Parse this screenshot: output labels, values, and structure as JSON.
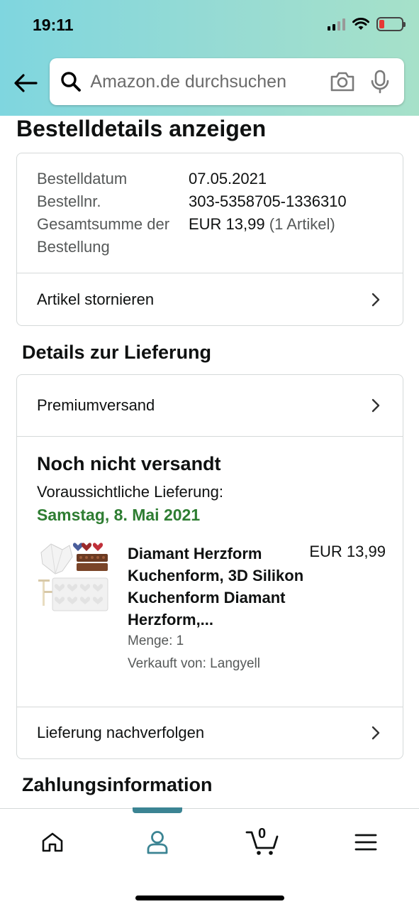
{
  "status_bar": {
    "time": "19:11"
  },
  "search": {
    "placeholder": "Amazon.de durchsuchen"
  },
  "page": {
    "title": "Bestelldetails anzeigen"
  },
  "order_summary": {
    "rows": [
      {
        "label": "Bestelldatum",
        "value": "07.05.2021"
      },
      {
        "label": "Bestellnr.",
        "value": "303-5358705-1336310"
      },
      {
        "label": "Gesamtsumme der Bestellung",
        "value": "EUR 13,99",
        "value_extra": "(1 Artikel)"
      }
    ],
    "cancel_label": "Artikel stornieren"
  },
  "delivery": {
    "section_title": "Details zur Lieferung",
    "shipping_method": "Premiumversand",
    "status": "Noch nicht versandt",
    "eta_label": "Voraussichtliche Lieferung:",
    "eta_date": "Samstag, 8. Mai 2021",
    "item": {
      "title": "Diamant Herzform Kuchenform, 3D Silikon Kuchenform Diamant Herzform,...",
      "price": "EUR 13,99",
      "quantity": "Menge: 1",
      "seller": "Verkauft von: Langyell"
    },
    "track_label": "Lieferung nachverfolgen"
  },
  "payment": {
    "section_title": "Zahlungsinformation"
  },
  "tabbar": {
    "cart_count": "0",
    "active_tab": "account",
    "icons": [
      "home-icon",
      "account-icon",
      "cart-icon",
      "menu-icon"
    ]
  },
  "colors": {
    "header_gradient_start": "#7fd6df",
    "header_gradient_end": "#a6e1c9",
    "eta_green": "#2e7d32",
    "active_tab_indicator": "#3b8493",
    "battery_low": "#e53935"
  }
}
